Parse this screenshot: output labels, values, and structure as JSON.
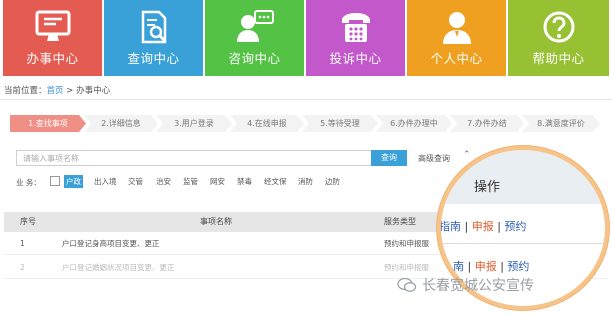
{
  "tiles": [
    {
      "label": "办事中心",
      "icon": "monitor-icon",
      "color": "#e35b51"
    },
    {
      "label": "查询中心",
      "icon": "document-search-icon",
      "color": "#3aa0d8"
    },
    {
      "label": "咨询中心",
      "icon": "chat-person-icon",
      "color": "#53c245"
    },
    {
      "label": "投诉中心",
      "icon": "telephone-icon",
      "color": "#c258c9"
    },
    {
      "label": "个人中心",
      "icon": "user-icon",
      "color": "#f0a021"
    },
    {
      "label": "帮助中心",
      "icon": "question-icon",
      "color": "#97c033"
    }
  ],
  "breadcrumb": {
    "prefix": "当前位置：",
    "home": "首页",
    "separator": " > ",
    "current": "办事中心"
  },
  "steps": [
    "1.查找事项",
    "2.详细信息",
    "3.用户登录",
    "4.在线申报",
    "5.等待受理",
    "6.办件办理中",
    "7.办件办结",
    "8.满意度评价"
  ],
  "search": {
    "placeholder": "请输入事项名称",
    "button": "查询",
    "advanced": "高级查询",
    "caret": "⌃"
  },
  "categories": {
    "label": "业 务：",
    "items": [
      "户政",
      "出入境",
      "交管",
      "治安",
      "监管",
      "网安",
      "禁毒",
      "经文保",
      "消防",
      "边防"
    ],
    "selected": "户政"
  },
  "table": {
    "headers": {
      "no": "序号",
      "name": "事项名称",
      "type": "服务类型"
    },
    "rows": [
      {
        "no": "1",
        "name": "户口登记身高项目变更、更正",
        "type": "预约和申报服"
      },
      {
        "no": "2",
        "name": "户口登记婚姻状况项目变更、更正",
        "type": "预约和申报服"
      }
    ]
  },
  "magnifier": {
    "header": "操作",
    "row1": {
      "a": "指南",
      "sep1": " | ",
      "b": "申报",
      "sep2": " | ",
      "c": "预约"
    },
    "row2": {
      "a": "南",
      "sep1": " | ",
      "b": "申报",
      "sep2": " | ",
      "c": "预约"
    }
  },
  "watermark": "长春宽城公安宣传",
  "colors": {
    "accent": "#3aa0d8",
    "active_step": "#f08f85",
    "bubble_ring": "#f6c48a"
  }
}
